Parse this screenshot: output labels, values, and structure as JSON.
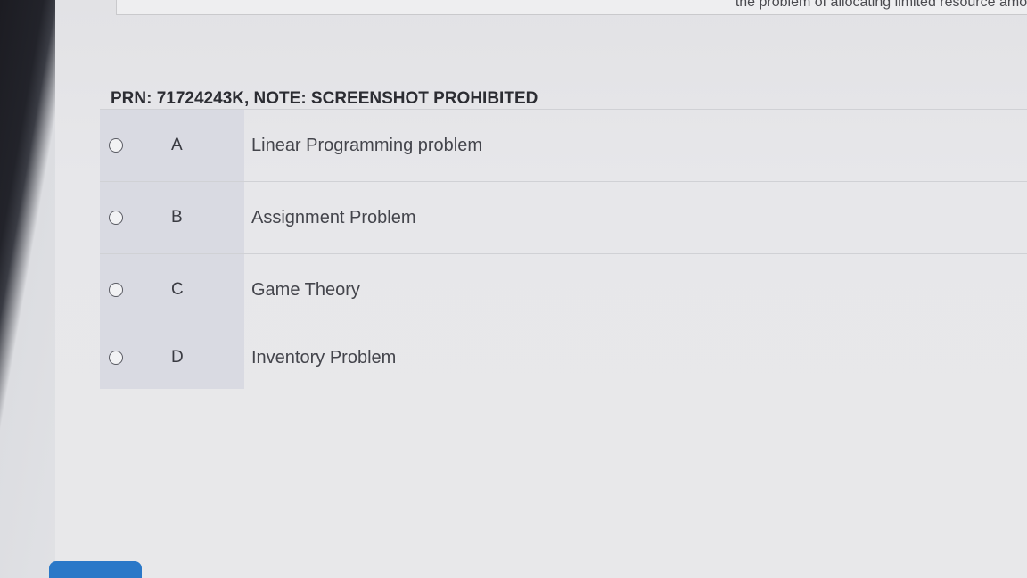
{
  "question": {
    "text_fragment": "the problem of allocating limited resource amon"
  },
  "header": {
    "prn_note": "PRN: 71724243K, NOTE: SCREENSHOT PROHIBITED"
  },
  "options": [
    {
      "letter": "A",
      "text": "Linear Programming problem"
    },
    {
      "letter": "B",
      "text": "Assignment Problem"
    },
    {
      "letter": "C",
      "text": "Game Theory"
    },
    {
      "letter": "D",
      "text": "Inventory Problem"
    }
  ],
  "colors": {
    "accent": "#2a78c8",
    "letter_column": "#d9dae2",
    "page_background": "#e8e8ea"
  },
  "icons": {
    "radio": "radio-button-icon"
  }
}
